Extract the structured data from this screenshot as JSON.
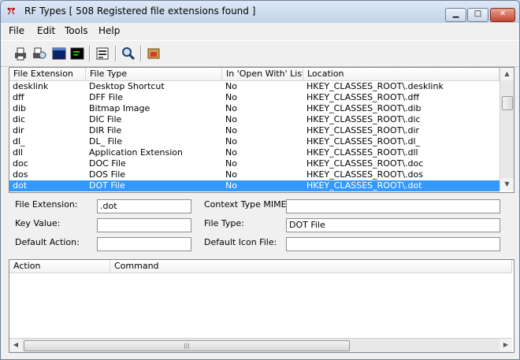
{
  "window": {
    "title": "RF Types [ 508 Registered file extensions found ]",
    "buttons": {
      "minimize": "▁",
      "maximize": "□",
      "close": "✕"
    }
  },
  "menu": [
    "File",
    "Edit",
    "Tools",
    "Help"
  ],
  "toolbar": {
    "buttons": [
      "print-icon",
      "print-preview-icon",
      "terminal-icon",
      "console-icon",
      "properties-icon",
      "search-icon",
      "backup-icon"
    ]
  },
  "list": {
    "columns": [
      "File Extension",
      "File Type",
      "In 'Open With' List",
      "Location"
    ],
    "rows": [
      [
        "desklink",
        "Desktop Shortcut",
        "No",
        "HKEY_CLASSES_ROOT\\.desklink"
      ],
      [
        "dff",
        "DFF File",
        "No",
        "HKEY_CLASSES_ROOT\\.dff"
      ],
      [
        "dib",
        "Bitmap Image",
        "No",
        "HKEY_CLASSES_ROOT\\.dib"
      ],
      [
        "dic",
        "DIC File",
        "No",
        "HKEY_CLASSES_ROOT\\.dic"
      ],
      [
        "dir",
        "DIR File",
        "No",
        "HKEY_CLASSES_ROOT\\.dir"
      ],
      [
        "dl_",
        "DL_ File",
        "No",
        "HKEY_CLASSES_ROOT\\.dl_"
      ],
      [
        "dll",
        "Application Extension",
        "No",
        "HKEY_CLASSES_ROOT\\.dll"
      ],
      [
        "doc",
        "DOC File",
        "No",
        "HKEY_CLASSES_ROOT\\.doc"
      ],
      [
        "dos",
        "DOS File",
        "No",
        "HKEY_CLASSES_ROOT\\.dos"
      ],
      [
        "dot",
        "DOT File",
        "No",
        "HKEY_CLASSES_ROOT\\.dot"
      ]
    ],
    "selected_index": 9
  },
  "details": {
    "file_extension_label": "File Extension:",
    "file_extension_value": ".dot",
    "key_value_label": "Key Value:",
    "key_value_value": "",
    "default_action_label": "Default Action:",
    "default_action_value": "",
    "context_mime_label": "Context Type MIME:",
    "context_mime_value": "",
    "file_type_label": "File Type:",
    "file_type_value": "DOT File",
    "default_icon_label": "Default Icon File:",
    "default_icon_value": ""
  },
  "commands": {
    "columns": [
      "Action",
      "Command"
    ]
  },
  "colors": {
    "selection": "#3399ff",
    "title_gradient_top": "#dde8f5",
    "close_button": "#c64530"
  }
}
